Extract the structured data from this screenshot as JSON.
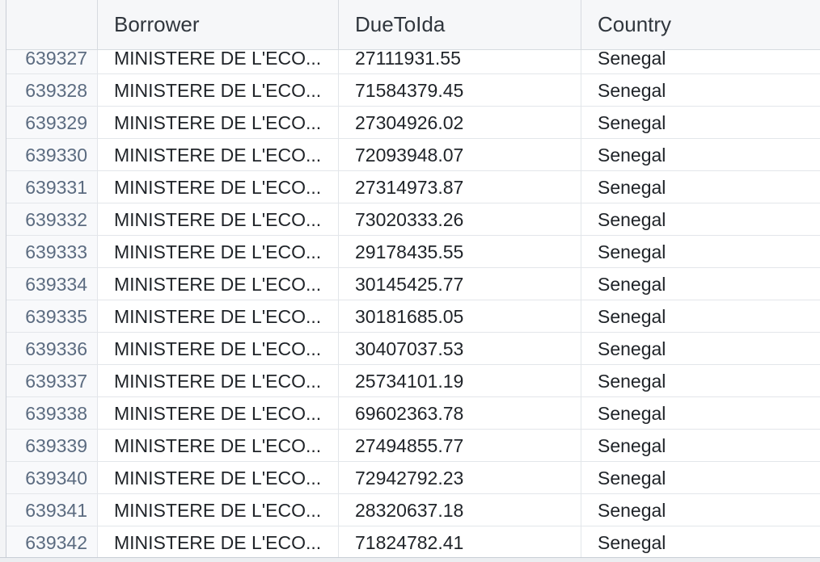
{
  "table": {
    "columns": [
      "",
      "Borrower",
      "DueToIda",
      "Country"
    ],
    "rows": [
      {
        "index": "639327",
        "borrower": "MINISTERE DE L'ECO...",
        "due": "27111931.55",
        "country": "Senegal"
      },
      {
        "index": "639328",
        "borrower": "MINISTERE DE L'ECO...",
        "due": "71584379.45",
        "country": "Senegal"
      },
      {
        "index": "639329",
        "borrower": "MINISTERE DE L'ECO...",
        "due": "27304926.02",
        "country": "Senegal"
      },
      {
        "index": "639330",
        "borrower": "MINISTERE DE L'ECO...",
        "due": "72093948.07",
        "country": "Senegal"
      },
      {
        "index": "639331",
        "borrower": "MINISTERE DE L'ECO...",
        "due": "27314973.87",
        "country": "Senegal"
      },
      {
        "index": "639332",
        "borrower": "MINISTERE DE L'ECO...",
        "due": "73020333.26",
        "country": "Senegal"
      },
      {
        "index": "639333",
        "borrower": "MINISTERE DE L'ECO...",
        "due": "29178435.55",
        "country": "Senegal"
      },
      {
        "index": "639334",
        "borrower": "MINISTERE DE L'ECO...",
        "due": "30145425.77",
        "country": "Senegal"
      },
      {
        "index": "639335",
        "borrower": "MINISTERE DE L'ECO...",
        "due": "30181685.05",
        "country": "Senegal"
      },
      {
        "index": "639336",
        "borrower": "MINISTERE DE L'ECO...",
        "due": "30407037.53",
        "country": "Senegal"
      },
      {
        "index": "639337",
        "borrower": "MINISTERE DE L'ECO...",
        "due": "25734101.19",
        "country": "Senegal"
      },
      {
        "index": "639338",
        "borrower": "MINISTERE DE L'ECO...",
        "due": "69602363.78",
        "country": "Senegal"
      },
      {
        "index": "639339",
        "borrower": "MINISTERE DE L'ECO...",
        "due": "27494855.77",
        "country": "Senegal"
      },
      {
        "index": "639340",
        "borrower": "MINISTERE DE L'ECO...",
        "due": "72942792.23",
        "country": "Senegal"
      },
      {
        "index": "639341",
        "borrower": "MINISTERE DE L'ECO...",
        "due": "28320637.18",
        "country": "Senegal"
      },
      {
        "index": "639342",
        "borrower": "MINISTERE DE L'ECO...",
        "due": "71824782.41",
        "country": "Senegal"
      }
    ]
  }
}
